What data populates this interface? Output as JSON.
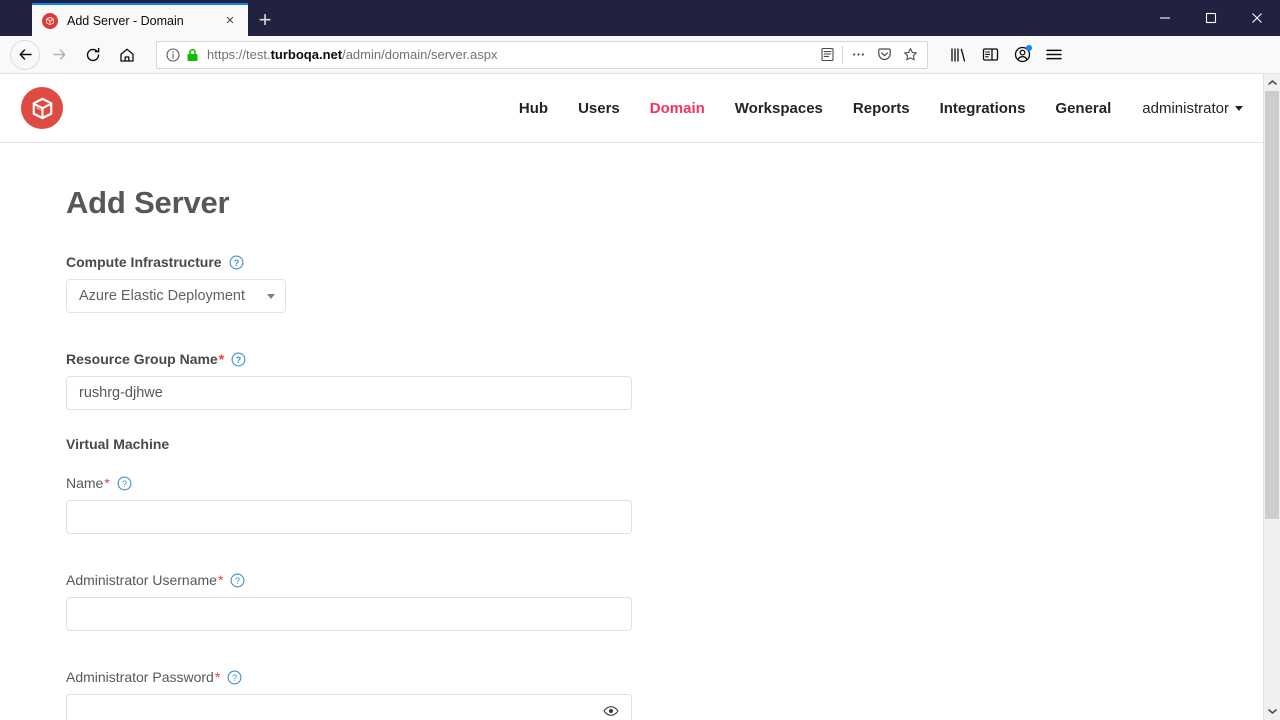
{
  "browser": {
    "tab": {
      "title": "Add Server - Domain",
      "favicon": "turbo-logo-icon",
      "close": "×"
    },
    "new_tab_label": "+",
    "window_controls": {
      "minimize": "minimize-icon",
      "maximize": "maximize-icon",
      "close": "close-icon"
    },
    "nav": {
      "back": "back-arrow-icon",
      "forward": "forward-arrow-icon",
      "reload": "reload-icon",
      "home": "home-icon"
    },
    "urlbar": {
      "identity": "page-info-icon",
      "lock": "lock-icon",
      "url_prefix": "https://test.",
      "url_domain": "turboqa.net",
      "url_suffix": "/admin/domain/server.aspx",
      "full_url": "https://test.turboqa.net/admin/domain/server.aspx",
      "reader": "reader-view-icon",
      "more": "page-actions-icon",
      "pocket": "pocket-icon",
      "bookmark": "star-icon"
    },
    "toolbar_right": {
      "library": "library-icon",
      "sidebar": "sidebar-icon",
      "account": "account-icon",
      "menu": "hamburger-menu-icon"
    }
  },
  "site": {
    "logo_alt": "turbo-logo",
    "brand_color": "#dd4b42",
    "active_color": "#f5325b",
    "nav_items": [
      {
        "label": "Hub",
        "active": false
      },
      {
        "label": "Users",
        "active": false
      },
      {
        "label": "Domain",
        "active": true
      },
      {
        "label": "Workspaces",
        "active": false
      },
      {
        "label": "Reports",
        "active": false
      },
      {
        "label": "Integrations",
        "active": false
      },
      {
        "label": "General",
        "active": false
      }
    ],
    "account_menu": "administrator"
  },
  "page": {
    "title": "Add Server",
    "fields": {
      "compute_infrastructure": {
        "label": "Compute Infrastructure",
        "required": false,
        "help": "?",
        "selected": "Azure Elastic Deployment"
      },
      "resource_group_name": {
        "label": "Resource Group Name",
        "required_mark": "*",
        "help": "?",
        "value": "rushrg-djhwe"
      },
      "virtual_machine_section": {
        "label": "Virtual Machine"
      },
      "vm_name": {
        "label": "Name",
        "required_mark": "*",
        "help": "?",
        "value": ""
      },
      "admin_username": {
        "label": "Administrator Username",
        "required_mark": "*",
        "help": "?",
        "value": ""
      },
      "admin_password": {
        "label": "Administrator Password",
        "required_mark": "*",
        "help": "?",
        "value": "",
        "toggle": "eye-icon"
      }
    }
  },
  "scrollbar": {
    "up": "chevron-up-icon",
    "down": "chevron-down-icon",
    "thumb_ratio": "70%"
  }
}
